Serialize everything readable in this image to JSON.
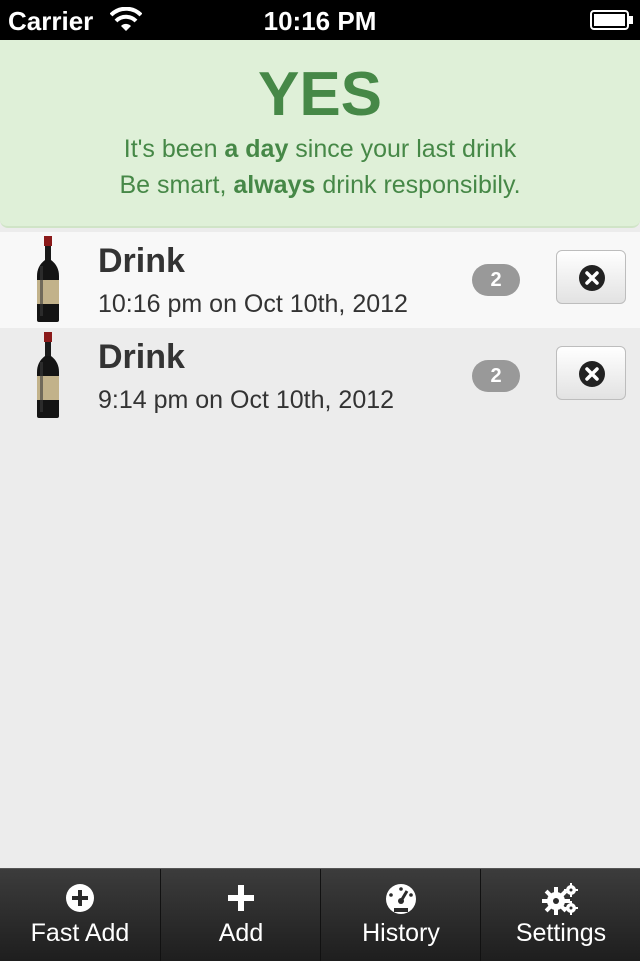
{
  "status_bar": {
    "carrier": "Carrier",
    "time": "10:16 PM"
  },
  "banner": {
    "title": "YES",
    "line1_before": "It's been ",
    "line1_bold": "a day",
    "line1_after": " since your last drink",
    "line2_before": "Be smart, ",
    "line2_bold": "always",
    "line2_after": " drink responsibily.",
    "color": "#468847",
    "background": "#dff0d8"
  },
  "drinks": [
    {
      "title": "Drink",
      "timestamp": "10:16 pm on Oct 10th, 2012",
      "count": "2",
      "icon": "wine-bottle-icon"
    },
    {
      "title": "Drink",
      "timestamp": "9:14 pm on Oct 10th, 2012",
      "count": "2",
      "icon": "wine-bottle-icon"
    }
  ],
  "tabbar": {
    "tabs": [
      {
        "label": "Fast Add",
        "icon": "plus-circle-icon"
      },
      {
        "label": "Add",
        "icon": "plus-icon"
      },
      {
        "label": "History",
        "icon": "dashboard-icon"
      },
      {
        "label": "Settings",
        "icon": "gears-icon"
      }
    ]
  }
}
